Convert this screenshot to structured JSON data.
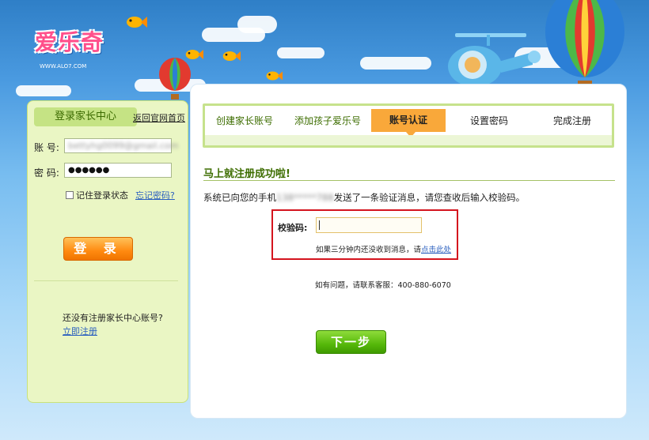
{
  "brand": {
    "logo_text": "爱乐奇",
    "logo_url": "WWW.ALO7.COM"
  },
  "login_panel": {
    "title": "登录家长中心",
    "home_link": "返回官网首页",
    "account_label": "账 号:",
    "account_value": "bettyhg0099@gmail.com",
    "password_label": "密 码:",
    "password_value": "●●●●●●",
    "remember_label": "记住登录状态",
    "forgot_link": "忘记密码?",
    "login_button": "登 录",
    "no_account_text": "还没有注册家长中心账号?",
    "register_link": "立即注册"
  },
  "steps": [
    {
      "label": "创建家长账号",
      "active": false
    },
    {
      "label": "添加孩子爱乐号",
      "active": false
    },
    {
      "label": "账号认证",
      "active": true
    },
    {
      "label": "设置密码",
      "active": false
    },
    {
      "label": "完成注册",
      "active": false
    }
  ],
  "main": {
    "success_title": "马上就注册成功啦!",
    "info_prefix": "系统已向您的手机",
    "phone_value": "138*****788",
    "info_suffix": "发送了一条验证消息，请您查收后输入校验码。",
    "code_label": "校验码:",
    "code_value": "",
    "hint_prefix": "如果三分钟内还没收到消息，请",
    "hint_link": "点击此处",
    "contact_text": "如有问题，请联系客服：400-880-6070",
    "next_button": "下一步"
  },
  "colors": {
    "sky_top": "#2f7fc7",
    "green_accent": "#3d6d00",
    "active_step": "#f9a83a",
    "login_orange": "#ff8a10",
    "next_green": "#56b80a",
    "highlight_red": "#d4141e"
  }
}
